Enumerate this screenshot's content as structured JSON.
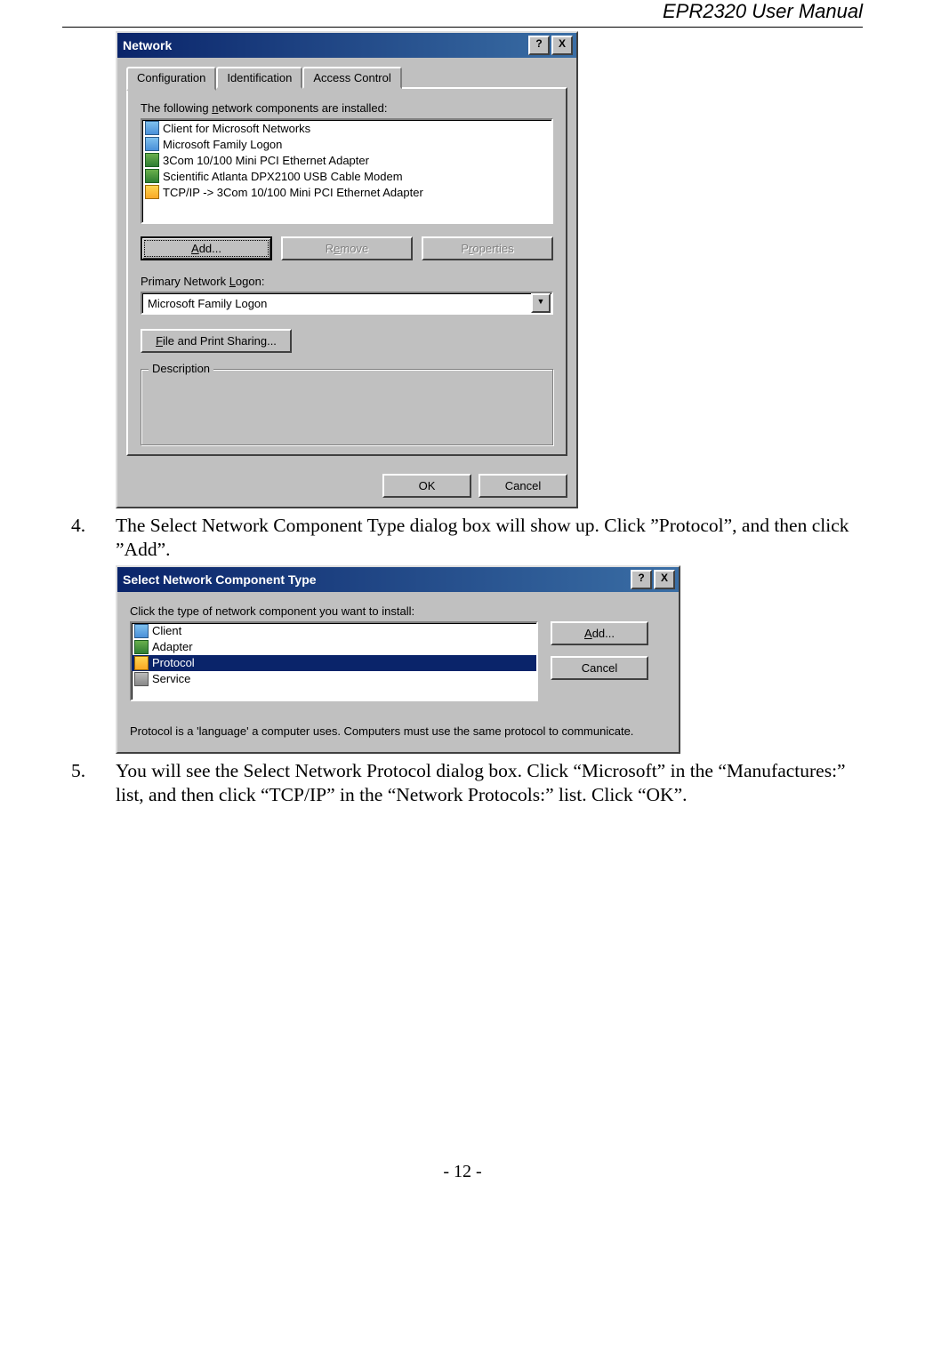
{
  "header": {
    "title_prefix": "EPR2320",
    "title_suffix": " User Manual"
  },
  "dialog1": {
    "title": "Network",
    "help_btn": "?",
    "close_btn": "X",
    "tabs": {
      "configuration": "Configuration",
      "identification": "Identification",
      "access_control": "Access Control"
    },
    "components_label": "The following network components are installed:",
    "components": [
      "Client for Microsoft Networks",
      "Microsoft Family Logon",
      "3Com 10/100 Mini PCI Ethernet Adapter",
      "Scientific Atlanta DPX2100 USB Cable Modem",
      "TCP/IP -> 3Com 10/100 Mini PCI Ethernet Adapter"
    ],
    "add_btn": "Add...",
    "remove_btn": "Remove",
    "properties_btn": "Properties",
    "primary_logon_label": "Primary Network Logon:",
    "primary_logon_value": "Microsoft Family Logon",
    "file_print_btn": "File and Print Sharing...",
    "description_legend": "Description",
    "ok_btn": "OK",
    "cancel_btn": "Cancel"
  },
  "step4": {
    "num": "4.",
    "text": "The Select Network Component Type dialog box will show up. Click ”Protocol”, and then click ”Add”."
  },
  "dialog2": {
    "title": "Select Network Component Type",
    "help_btn": "?",
    "close_btn": "X",
    "instruction": "Click the type of network component you want to install:",
    "items": {
      "client": "Client",
      "adapter": "Adapter",
      "protocol": "Protocol",
      "service": "Service"
    },
    "add_btn": "Add...",
    "cancel_btn": "Cancel",
    "description": "Protocol is a 'language' a computer uses. Computers must use the same protocol to communicate."
  },
  "step5": {
    "num": "5.",
    "text": "You will see the Select Network Protocol dialog box. Click “Microsoft” in the “Manufactures:” list, and then click “TCP/IP” in the “Network Protocols:” list. Click “OK”."
  },
  "footer": {
    "page": "- 12 -"
  }
}
